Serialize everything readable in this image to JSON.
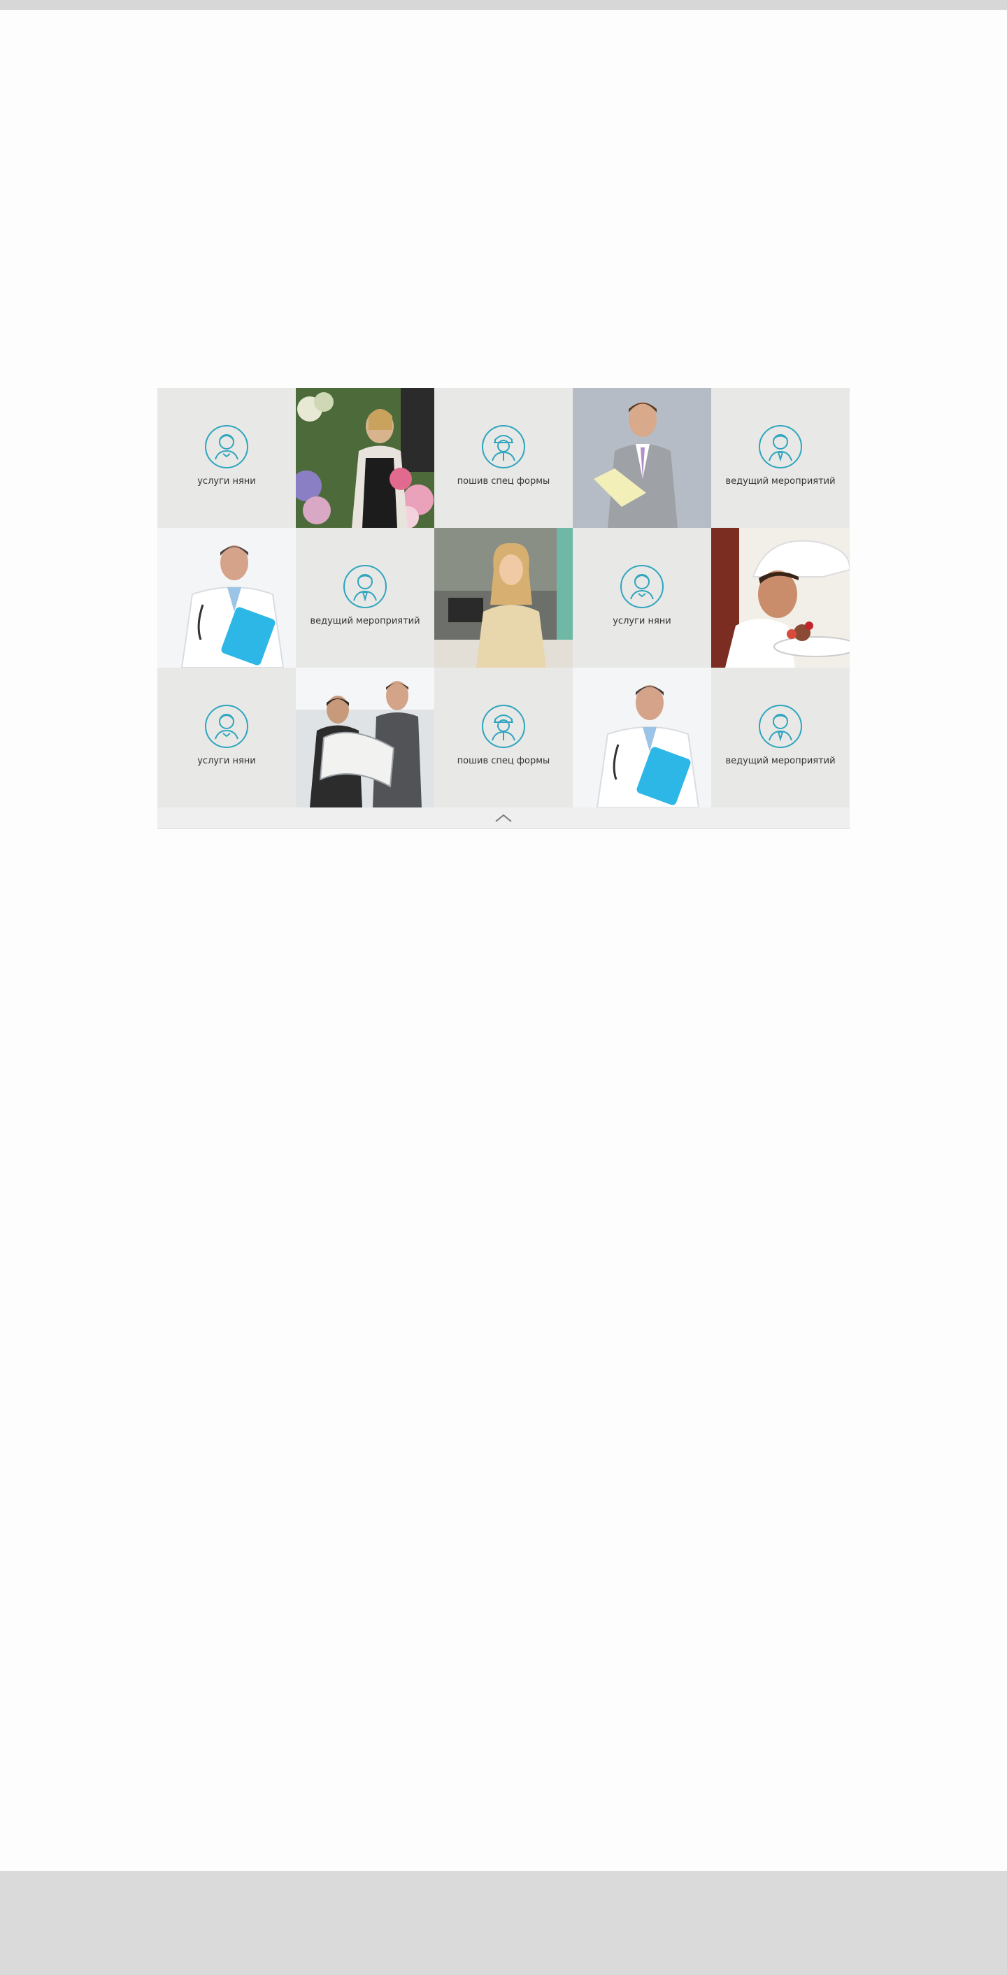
{
  "colors": {
    "icon_accent": "#2fa5be",
    "tile_gray": "#e8e8e6",
    "label_text": "#333333",
    "header_bar": "#d7d7d7",
    "footer_bar": "#dadada"
  },
  "grid": {
    "row1": {
      "c1": {
        "kind": "service",
        "icon": "nanny-icon",
        "label": "услуги няни"
      },
      "c2": {
        "kind": "photo",
        "icon": "florist-photo"
      },
      "c3": {
        "kind": "service",
        "icon": "worker-cap-icon",
        "label": "пошив спец формы"
      },
      "c4": {
        "kind": "photo",
        "icon": "businessman-photo"
      },
      "c5": {
        "kind": "service",
        "icon": "host-icon",
        "label": "ведущий мероприятий"
      }
    },
    "row2": {
      "c1": {
        "kind": "photo",
        "icon": "doctor-photo"
      },
      "c2": {
        "kind": "service",
        "icon": "host-icon",
        "label": "ведущий мероприятий"
      },
      "c3": {
        "kind": "photo",
        "icon": "operator-photo"
      },
      "c4": {
        "kind": "service",
        "icon": "nanny-icon",
        "label": "услуги няни"
      },
      "c5": {
        "kind": "photo",
        "icon": "chef-photo"
      }
    },
    "row3": {
      "c1": {
        "kind": "service",
        "icon": "nanny-icon",
        "label": "услуги няни"
      },
      "c2": {
        "kind": "photo",
        "icon": "architects-photo"
      },
      "c3": {
        "kind": "service",
        "icon": "worker-cap-icon",
        "label": "пошив спец формы"
      },
      "c4": {
        "kind": "photo",
        "icon": "doctor-photo"
      },
      "c5": {
        "kind": "service",
        "icon": "host-icon",
        "label": "ведущий мероприятий"
      }
    }
  },
  "collapse": {
    "icon": "chevron-up-icon"
  }
}
